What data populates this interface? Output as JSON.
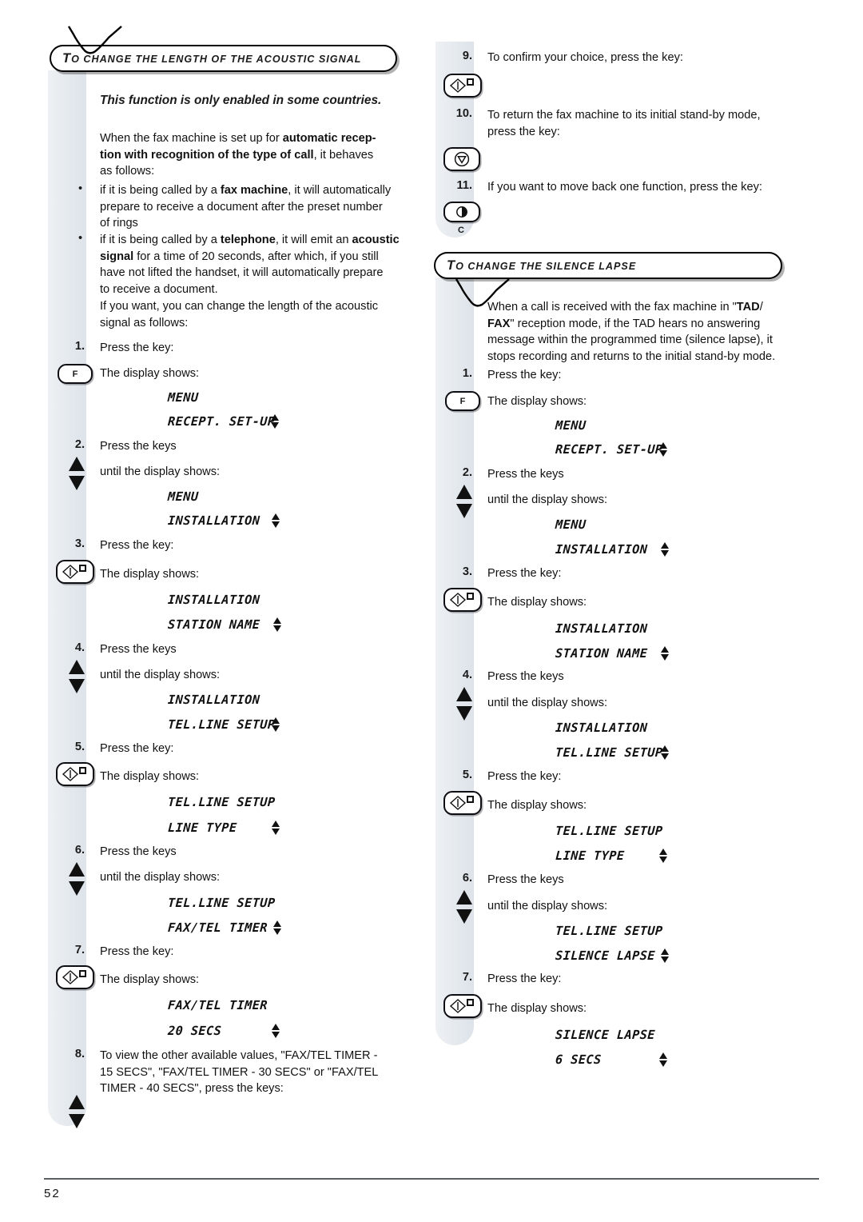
{
  "page": {
    "number": "52"
  },
  "sections": [
    {
      "id": "acoustic-signal",
      "heading_cap": "T",
      "heading_rest": "O CHANGE THE LENGTH OF THE ACOUSTIC SIGNAL",
      "intro_italic": "This function is only enabled in some countries.",
      "paragraphs": [
        "When the fax machine is set up for automatic reception with recognition of the type of call, it behaves as follows:"
      ],
      "bullets": [
        "if it is being called by a fax machine, it will automatically prepare to receive a document after the preset number of rings",
        "if it is being called by a telephone, it will emit an acoustic signal for a time of 20 seconds, after which, if you still have not lifted the handset, it will automatically prepare to receive a document."
      ],
      "closing": "If you want, you can change the length of the acoustic signal as follows:",
      "steps": [
        {
          "n": "1.",
          "text": "Press the key:",
          "key": "F",
          "after": "The display shows:",
          "lcd": [
            "MENU",
            "RECEPT. SET-UP"
          ]
        },
        {
          "n": "2.",
          "text": "Press the keys",
          "key": "updown",
          "after": "until the display shows:",
          "lcd": [
            "MENU",
            "INSTALLATION"
          ]
        },
        {
          "n": "3.",
          "text": "Press the key:",
          "key": "start",
          "after": "The display shows:",
          "lcd": [
            "INSTALLATION",
            "STATION NAME"
          ]
        },
        {
          "n": "4.",
          "text": "Press the keys",
          "key": "updown",
          "after": "until the display shows:",
          "lcd": [
            "INSTALLATION",
            "TEL.LINE SETUP"
          ]
        },
        {
          "n": "5.",
          "text": "Press the key:",
          "key": "start",
          "after": "The display shows:",
          "lcd": [
            "TEL.LINE SETUP",
            "LINE TYPE"
          ]
        },
        {
          "n": "6.",
          "text": "Press the keys",
          "key": "updown",
          "after": "until the display shows:",
          "lcd": [
            "TEL.LINE SETUP",
            "FAX/TEL TIMER"
          ]
        },
        {
          "n": "7.",
          "text": "Press the key:",
          "key": "start",
          "after": "The display shows:",
          "lcd": [
            "FAX/TEL TIMER",
            "20 SECS"
          ]
        },
        {
          "n": "8.",
          "text": "To view the other available values, \"FAX/TEL TIMER - 15 SECS\", \"FAX/TEL TIMER - 30 SECS\" or \"FAX/TEL TIMER - 40 SECS\", press the keys:",
          "key": "updown",
          "after": "",
          "lcd": []
        }
      ]
    },
    {
      "id": "silence-lapse",
      "heading_cap": "T",
      "heading_rest": "O CHANGE THE SILENCE LAPSE",
      "paragraphs": [
        "When a call is received with the fax machine in \"TAD/FAX\" reception mode, if the TAD hears no answering message within the programmed time (silence lapse), it stops recording and returns to the initial stand-by mode."
      ],
      "steps": [
        {
          "n": "1.",
          "text": "Press the key:",
          "key": "F",
          "after": "The display shows:",
          "lcd": [
            "MENU",
            "RECEPT. SET-UP"
          ]
        },
        {
          "n": "2.",
          "text": "Press the keys",
          "key": "updown",
          "after": "until the display shows:",
          "lcd": [
            "MENU",
            "INSTALLATION"
          ]
        },
        {
          "n": "3.",
          "text": "Press the key:",
          "key": "start",
          "after": "The display shows:",
          "lcd": [
            "INSTALLATION",
            "STATION NAME"
          ]
        },
        {
          "n": "4.",
          "text": "Press the keys",
          "key": "updown",
          "after": "until the display shows:",
          "lcd": [
            "INSTALLATION",
            "TEL.LINE SETUP"
          ]
        },
        {
          "n": "5.",
          "text": "Press the key:",
          "key": "start",
          "after": "The display shows:",
          "lcd": [
            "TEL.LINE SETUP",
            "LINE TYPE"
          ]
        },
        {
          "n": "6.",
          "text": "Press the keys",
          "key": "updown",
          "after": "until the display shows:",
          "lcd": [
            "TEL.LINE SETUP",
            "SILENCE LAPSE"
          ]
        },
        {
          "n": "7.",
          "text": "Press the key:",
          "key": "start",
          "after": "The display shows:",
          "lcd": [
            "SILENCE LAPSE",
            "6 SECS"
          ]
        }
      ]
    }
  ],
  "right_top_steps": [
    {
      "n": "9.",
      "text": "To confirm your choice, press the key:",
      "key": "start"
    },
    {
      "n": "10.",
      "text": "To return the fax machine to its initial stand-by mode, press the key:",
      "key": "stop"
    },
    {
      "n": "11.",
      "text": "If you want to move back one function, press the key:",
      "key": "c",
      "key_label": "C"
    }
  ],
  "labels": {
    "key_f": "F",
    "key_c": "C"
  },
  "text_fragments": {
    "L_para1_a": "When the fax machine is set up for ",
    "L_para1_b": "automatic recep-",
    "L_para1_c": "tion with recognition of the type of call",
    "L_para1_d": ", it behaves",
    "L_para1_e": "as follows:",
    "L_b1_l1a": "if it is being called by a ",
    "L_b1_l1b": "fax machine",
    "L_b1_l1c": ", it will automatically",
    "L_b1_l2": "prepare to receive a document after the preset number",
    "L_b1_l3": "of rings",
    "L_b2_l1a": "if it is being called by a ",
    "L_b2_l1b": "telephone",
    "L_b2_l1c": ", it will emit an ",
    "L_b2_l1d": "acoustic",
    "L_b2_l2a": "signal",
    "L_b2_l2b": " for a time of 20 seconds, after which, if you still",
    "L_b2_l3": "have not lifted the handset, it will automatically prepare",
    "L_b2_l4": "to receive a document.",
    "L_close_l1": "If you want, you can change the length of the acoustic",
    "L_close_l2": "signal as follows:",
    "L_s8_l1": "To view the other available values, \"FAX/TEL TIMER -",
    "L_s8_l2": "15 SECS\", \"FAX/TEL TIMER - 30 SECS\" or \"FAX/TEL",
    "L_s8_l3": "TIMER - 40 SECS\", press the keys:",
    "R_s10_l1": "To return the fax machine to its initial stand-by mode,",
    "R_s10_l2": "press the key:",
    "R_p1_l1a": "When a call is received with the fax machine in \"",
    "R_p1_l1b": "TAD",
    "R_p1_l1c": "/",
    "R_p1_l2a": "FAX",
    "R_p1_l2b": "\" reception mode, if the TAD hears no answering",
    "R_p1_l3": "message within the programmed time (silence lapse), it",
    "R_p1_l4": "stops recording and returns to the initial stand-by mode.",
    "display_shows": "The display shows:",
    "until_display_shows": "until the display shows:",
    "press_key": "Press the key:",
    "press_keys": "Press the keys",
    "step9": "To confirm your choice, press the key:",
    "step11": "If you want to move back one function, press the key:"
  }
}
